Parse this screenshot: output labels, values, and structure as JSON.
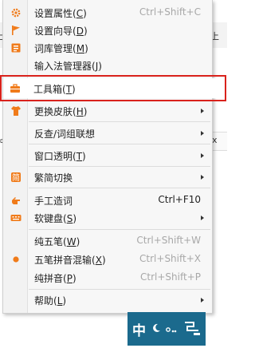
{
  "background": {
    "left_char_1": "上",
    "right_char_1": "上",
    "left_char_2": "<",
    "right_text_2": "x"
  },
  "menu": {
    "items": [
      {
        "icon": "gear-icon",
        "label": "设置属性",
        "mnemonic": "C",
        "shortcut": "Ctrl+Shift+C",
        "shortcut_enabled": false
      },
      {
        "icon": "flag-icon",
        "label": "设置向导",
        "mnemonic": "D",
        "shortcut": "",
        "shortcut_enabled": false
      },
      {
        "icon": "dictionary-icon",
        "label": "词库管理",
        "mnemonic": "M",
        "shortcut": "",
        "shortcut_enabled": false
      },
      {
        "icon": "",
        "label": "输入法管理器",
        "mnemonic": "J",
        "shortcut": "",
        "shortcut_enabled": false
      },
      {
        "icon": "toolbox-icon",
        "label": "工具箱",
        "mnemonic": "T",
        "shortcut": "",
        "shortcut_enabled": false
      },
      {
        "icon": "shirt-icon",
        "label": "更换皮肤",
        "mnemonic": "H",
        "shortcut": "",
        "shortcut_enabled": false,
        "submenu": true
      },
      {
        "icon": "",
        "label": "反查/词组联想",
        "mnemonic": "",
        "shortcut": "",
        "submenu": true
      },
      {
        "icon": "",
        "label": "窗口透明",
        "mnemonic": "T",
        "shortcut": "",
        "submenu": true
      },
      {
        "icon": "traditional-simplified-icon",
        "label": "繁简切换",
        "mnemonic": "",
        "shortcut": "",
        "submenu": true
      },
      {
        "icon": "hand-icon",
        "label": "手工造词",
        "mnemonic": "",
        "shortcut": "Ctrl+F10",
        "shortcut_enabled": true
      },
      {
        "icon": "keyboard-icon",
        "label": "软键盘",
        "mnemonic": "S",
        "shortcut": "",
        "submenu": true
      },
      {
        "icon": "",
        "label": "纯五笔",
        "mnemonic": "W",
        "shortcut": "Ctrl+Shift+W",
        "shortcut_enabled": false
      },
      {
        "icon": "bullet-icon",
        "label": "五笔拼音混输",
        "mnemonic": "X",
        "shortcut": "Ctrl+Shift+X",
        "shortcut_enabled": false
      },
      {
        "icon": "",
        "label": "纯拼音",
        "mnemonic": "P",
        "shortcut": "Ctrl+Shift+P",
        "shortcut_enabled": false
      },
      {
        "icon": "",
        "label": "帮助",
        "mnemonic": "L",
        "shortcut": "",
        "submenu": true
      }
    ]
  },
  "ime_bar": {
    "mode_label": "中"
  },
  "colors": {
    "accent_orange": "#f07b1a",
    "highlight_red": "#d9221c",
    "ime_bar_bg": "#1b6a8d"
  }
}
